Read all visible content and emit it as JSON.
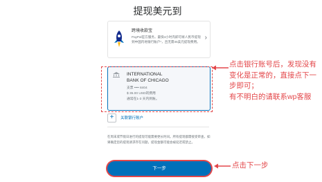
{
  "header": {
    "title": "提现美元到"
  },
  "paypal_card": {
    "title": "跨境收款宝",
    "description": "PayPal官方服务，最快4小时内即可将人民币提现到中国内地银行账户*，且无需35美元提现费用。",
    "chevron_icon": "chevron-right-icon",
    "icon": "rocket-icon"
  },
  "bank_card": {
    "icon": "bank-icon",
    "name_line1": "INTERNATIONAL",
    "name_line2": "BANK OF CHICAGO",
    "account": "支票 •••• 8404",
    "fee": "$ 35.00 USD的费用",
    "eta": "通常在1-3 天内到账。"
  },
  "add_bank": {
    "icon": "plus-icon",
    "label": "关联银行账户"
  },
  "notice": "在周末或节假日进行的提现可能需要更长时间。所有提现都需接受审查，如果确定您的提现请求存在问题，提现金额可能会被延迟或禁止。",
  "next_button": {
    "label": "下一步"
  },
  "annotations": {
    "bank_note_lines": [
      "点击银行账号后，发现没有",
      "变化是正常的，直接点下一",
      "步即可；",
      "有不明白的请联系wp客服"
    ],
    "button_note": "点击下一步",
    "color": "#e3474a"
  },
  "colors": {
    "accent": "#0070ba",
    "annotation": "#e3474a"
  }
}
